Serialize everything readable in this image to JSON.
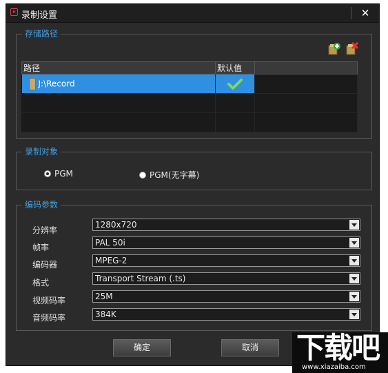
{
  "window": {
    "title": "录制设置",
    "close_label": "✕"
  },
  "storage": {
    "legend": "存储路径",
    "columns": [
      "路径",
      "默认值"
    ],
    "rows": [
      {
        "path": "J:\\Record",
        "is_default": true
      }
    ]
  },
  "record_target": {
    "legend": "录制对象",
    "options": [
      {
        "label": "PGM",
        "selected": true
      },
      {
        "label": "PGM(无字幕)",
        "selected": false
      }
    ]
  },
  "encoding": {
    "legend": "编码参数",
    "fields": [
      {
        "label": "分辨率",
        "value": "1280x720"
      },
      {
        "label": "帧率",
        "value": "PAL 50i"
      },
      {
        "label": "编码器",
        "value": "MPEG-2"
      },
      {
        "label": "格式",
        "value": "Transport Stream (.ts)"
      },
      {
        "label": "视频码率",
        "value": "25M"
      },
      {
        "label": "音频码率",
        "value": "384K"
      }
    ]
  },
  "buttons": {
    "ok": "确定",
    "cancel": "取消"
  },
  "watermark": {
    "main": "下载吧",
    "sub": "www.xiazaiba.com"
  }
}
